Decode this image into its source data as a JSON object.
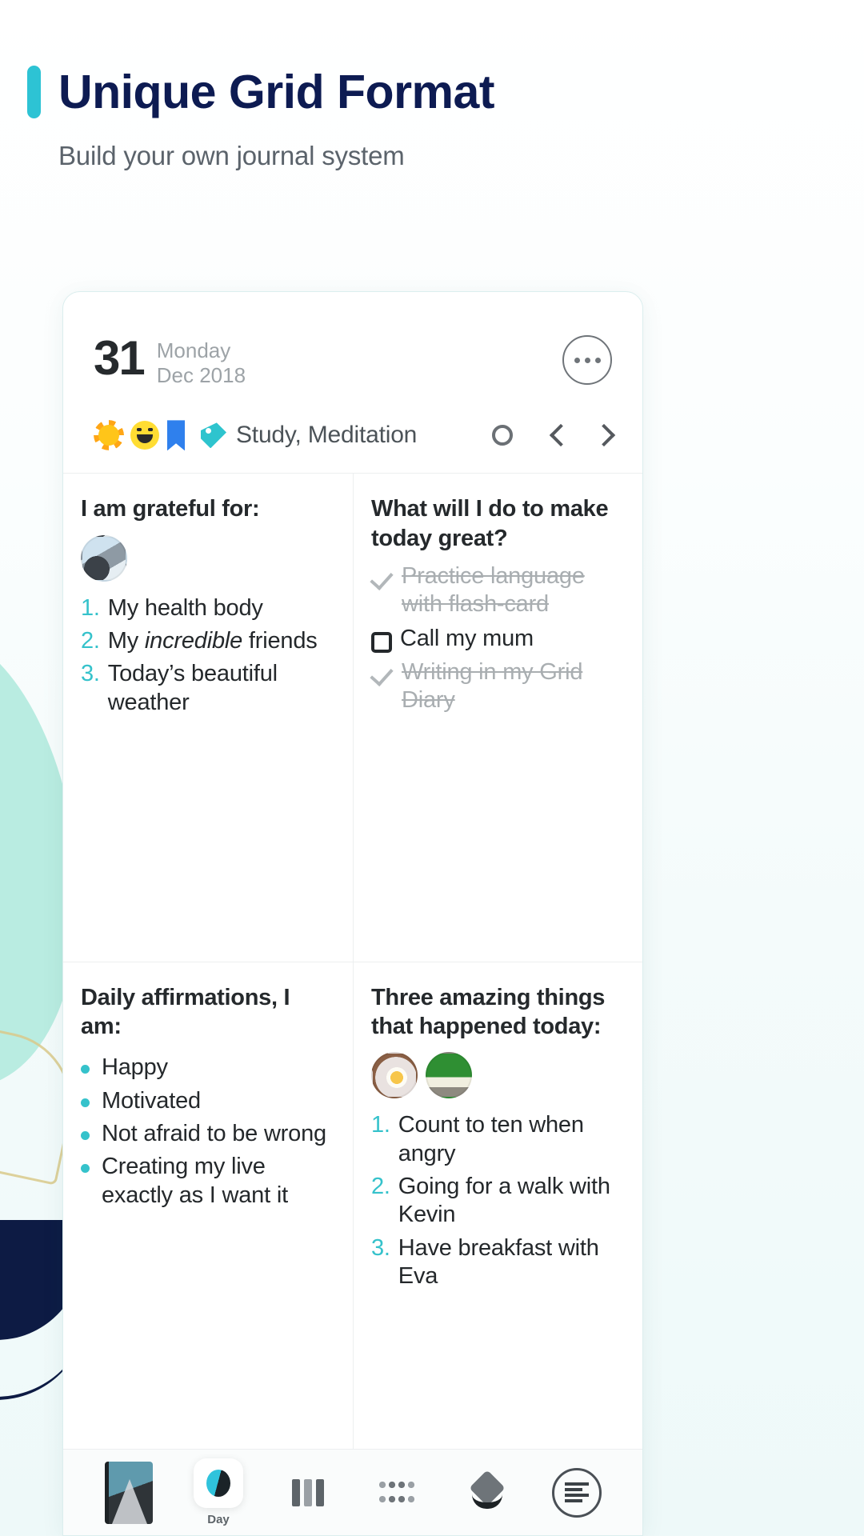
{
  "header": {
    "title": "Unique Grid Format",
    "subtitle": "Build your own journal system",
    "accent_color": "#2dc3d4",
    "title_color": "#0d1b52"
  },
  "journal": {
    "date": {
      "day": "31",
      "weekday": "Monday",
      "month_year": "Dec 2018"
    },
    "more_button": "more-options",
    "meta": {
      "icons": [
        "sun-icon",
        "smiley-icon",
        "bookmark-icon",
        "tag-icon"
      ],
      "tags": "Study, Meditation",
      "circle": "circle-icon",
      "prev": "chevron-left-icon",
      "next": "chevron-right-icon"
    },
    "quadrants": [
      {
        "name": "gratitude",
        "title": "I am grateful for:",
        "thumbnails": [
          "people-photo"
        ],
        "list_type": "numbered",
        "items": [
          {
            "num": "1.",
            "text": "My health body"
          },
          {
            "num": "2.",
            "text": "My ",
            "italic": "incredible",
            "text2": " friends"
          },
          {
            "num": "3.",
            "text": "Today’s beautiful weather"
          }
        ]
      },
      {
        "name": "make-today-great",
        "title": "What will I do to make today great?",
        "list_type": "checklist",
        "items": [
          {
            "state": "done",
            "text": "Practice language with flash-card"
          },
          {
            "state": "open",
            "text": "Call my mum"
          },
          {
            "state": "done",
            "text": "Writing in my Grid Diary"
          }
        ]
      },
      {
        "name": "daily-affirmations",
        "title": "Daily affirmations, I am:",
        "list_type": "bulleted",
        "items": [
          {
            "text": "Happy"
          },
          {
            "text": "Motivated"
          },
          {
            "text": "Not afraid to be wrong"
          },
          {
            "text": "Creating my live exactly as I want it"
          }
        ]
      },
      {
        "name": "three-amazing-things",
        "title": "Three amazing things that happened today:",
        "thumbnails": [
          "food-photo",
          "car-photo"
        ],
        "list_type": "numbered",
        "items": [
          {
            "num": "1.",
            "text": "Count to ten when angry"
          },
          {
            "num": "2.",
            "text": "Going for a walk with Kevin"
          },
          {
            "num": "3.",
            "text": "Have breakfast with Eva"
          }
        ]
      }
    ],
    "tabbar": [
      {
        "name": "book-icon",
        "label": ""
      },
      {
        "name": "day-icon",
        "label": "Day"
      },
      {
        "name": "columns-icon",
        "label": ""
      },
      {
        "name": "dots-icon",
        "label": ""
      },
      {
        "name": "layers-icon",
        "label": ""
      },
      {
        "name": "list-icon",
        "label": ""
      }
    ]
  },
  "colors": {
    "teal": "#35c2cb",
    "navy": "#0d1b52",
    "mint": "#b9ece1"
  }
}
